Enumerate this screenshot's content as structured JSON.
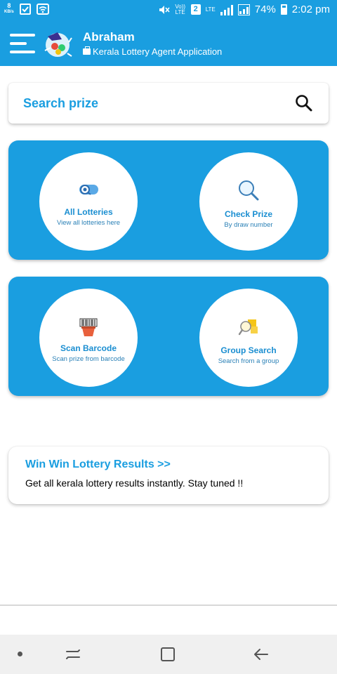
{
  "status_bar": {
    "speed_value": "8",
    "speed_unit": "KB/s",
    "volte": "Vo)) LTE",
    "sim_slot": "2",
    "network": "LTE",
    "battery": "74%",
    "time": "2:02 pm"
  },
  "app_bar": {
    "title": "Abraham",
    "subtitle": "Kerala Lottery Agent Application"
  },
  "search": {
    "placeholder": "Search prize"
  },
  "tiles": [
    {
      "title": "All Lotteries",
      "subtitle": "View all lotteries here",
      "icon": "lottery-ticket-icon"
    },
    {
      "title": "Check Prize",
      "subtitle": "By draw number",
      "icon": "magnifier-icon"
    },
    {
      "title": "Scan Barcode",
      "subtitle": "Scan prize from barcode",
      "icon": "barcode-scanner-icon"
    },
    {
      "title": "Group Search",
      "subtitle": "Search from a group",
      "icon": "group-search-icon"
    }
  ],
  "results_card": {
    "title": "Win Win Lottery Results >>",
    "text": "Get all kerala lottery results instantly. Stay tuned !!"
  },
  "colors": {
    "primary": "#1a9ee0",
    "tile_text": "#1a8ed1",
    "background": "#ffffff"
  }
}
